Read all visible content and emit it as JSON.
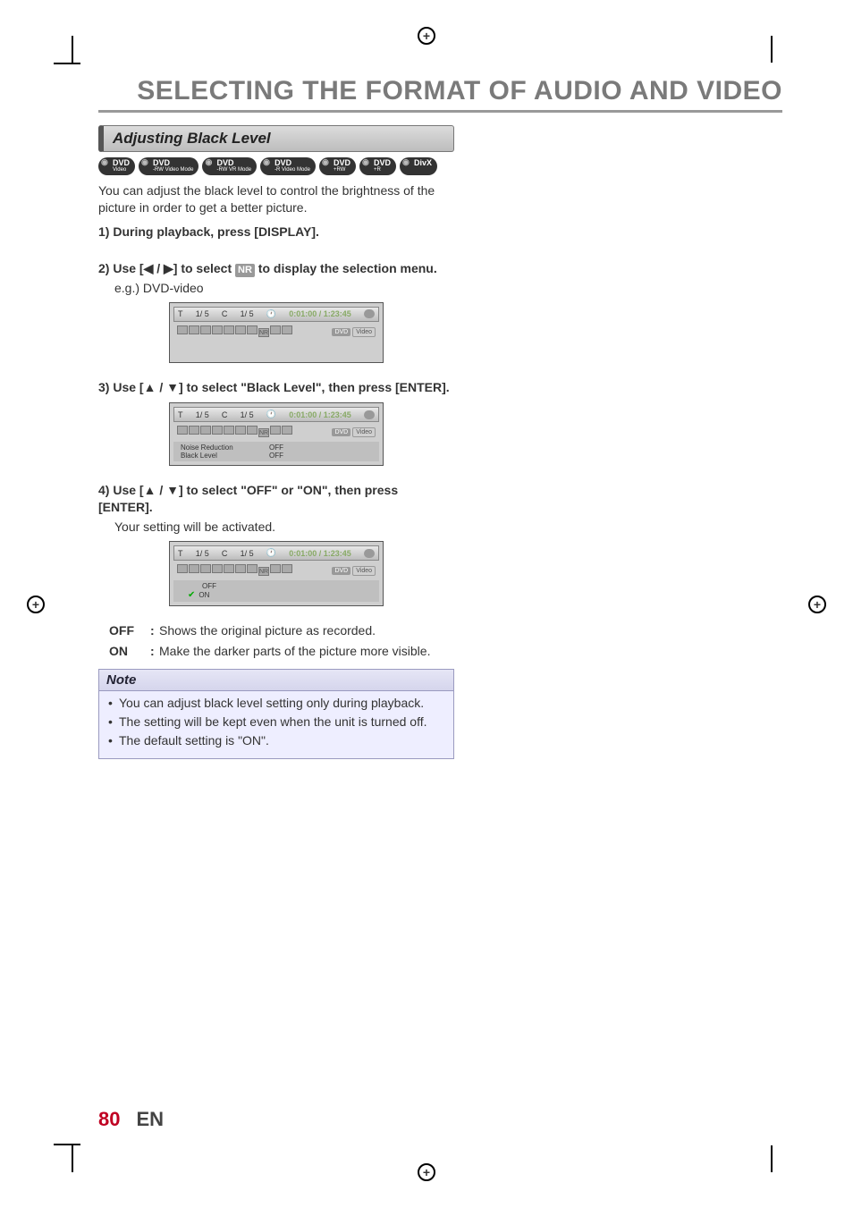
{
  "header": {
    "title": "SELECTING THE FORMAT OF AUDIO AND VIDEO"
  },
  "section": {
    "title": "Adjusting Black Level"
  },
  "badges": [
    {
      "main": "DVD",
      "sub": "Video"
    },
    {
      "main": "DVD",
      "sub": "-RW Video Mode"
    },
    {
      "main": "DVD",
      "sub": "-RW VR Mode"
    },
    {
      "main": "DVD",
      "sub": "-R Video Mode"
    },
    {
      "main": "DVD",
      "sub": "+RW"
    },
    {
      "main": "DVD",
      "sub": "+R"
    },
    {
      "main": "DivX",
      "sub": ""
    }
  ],
  "intro": "You can adjust the black level to control the brightness of the picture in order to get a better picture.",
  "step1": {
    "lead": "1) During playback, press [DISPLAY]."
  },
  "step2": {
    "lead_a": "2) Use [",
    "arrows": "◀ / ▶",
    "lead_b": "] to select ",
    "chip": "NR",
    "lead_c": " to display the selection menu.",
    "eg": "e.g.) DVD-video"
  },
  "osd_common": {
    "t_label": "T",
    "tc": "1/  5",
    "c_label": "C",
    "cc": "1/  5",
    "clock": "🕐",
    "time": "0:01:00 / 1:23:45",
    "nr": "NR",
    "tag1": "DVD",
    "tag2": "Video"
  },
  "step3": {
    "lead_a": "3) Use [",
    "arrows": "▲ / ▼",
    "lead_b": "] to select \"Black Level\", then press [ENTER].",
    "menu": {
      "row1_label": "Noise Reduction",
      "row1_value": "OFF",
      "row2_label": "Black Level",
      "row2_value": "OFF"
    }
  },
  "step4": {
    "lead_a": "4) Use [",
    "arrows": "▲ / ▼",
    "lead_b": "] to select \"OFF\" or \"ON\", then press [ENTER].",
    "post": "Your setting will be activated.",
    "options": {
      "off": "OFF",
      "on": "ON"
    }
  },
  "settings": {
    "off": {
      "key": "OFF",
      "desc": "Shows the original picture as recorded."
    },
    "on": {
      "key": "ON",
      "desc": "Make the darker parts of the picture more visible."
    }
  },
  "note": {
    "title": "Note",
    "items": [
      "You can adjust black level setting only during playback.",
      "The setting will be kept even when the unit is turned off.",
      "The default setting is \"ON\"."
    ]
  },
  "footer": {
    "page": "80",
    "lang": "EN"
  }
}
